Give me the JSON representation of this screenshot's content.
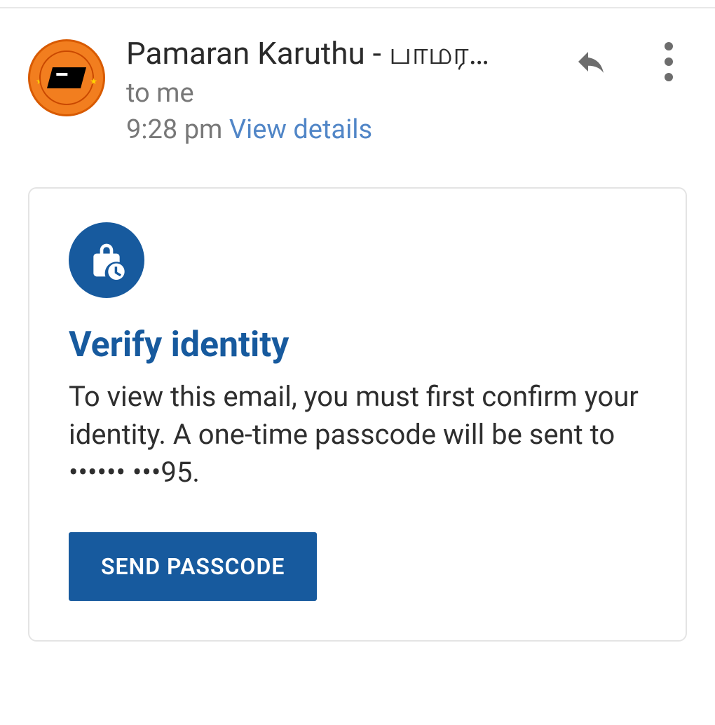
{
  "header": {
    "sender": "Pamaran Karuthu - பாமர…",
    "recipient": "to me",
    "time": "9:28 pm",
    "view_details": "View details"
  },
  "card": {
    "title": "Verify identity",
    "body": "To view this email, you must first confirm your identity. A one-time passcode will be sent to •••••• •••95.",
    "button": "SEND PASSCODE"
  }
}
